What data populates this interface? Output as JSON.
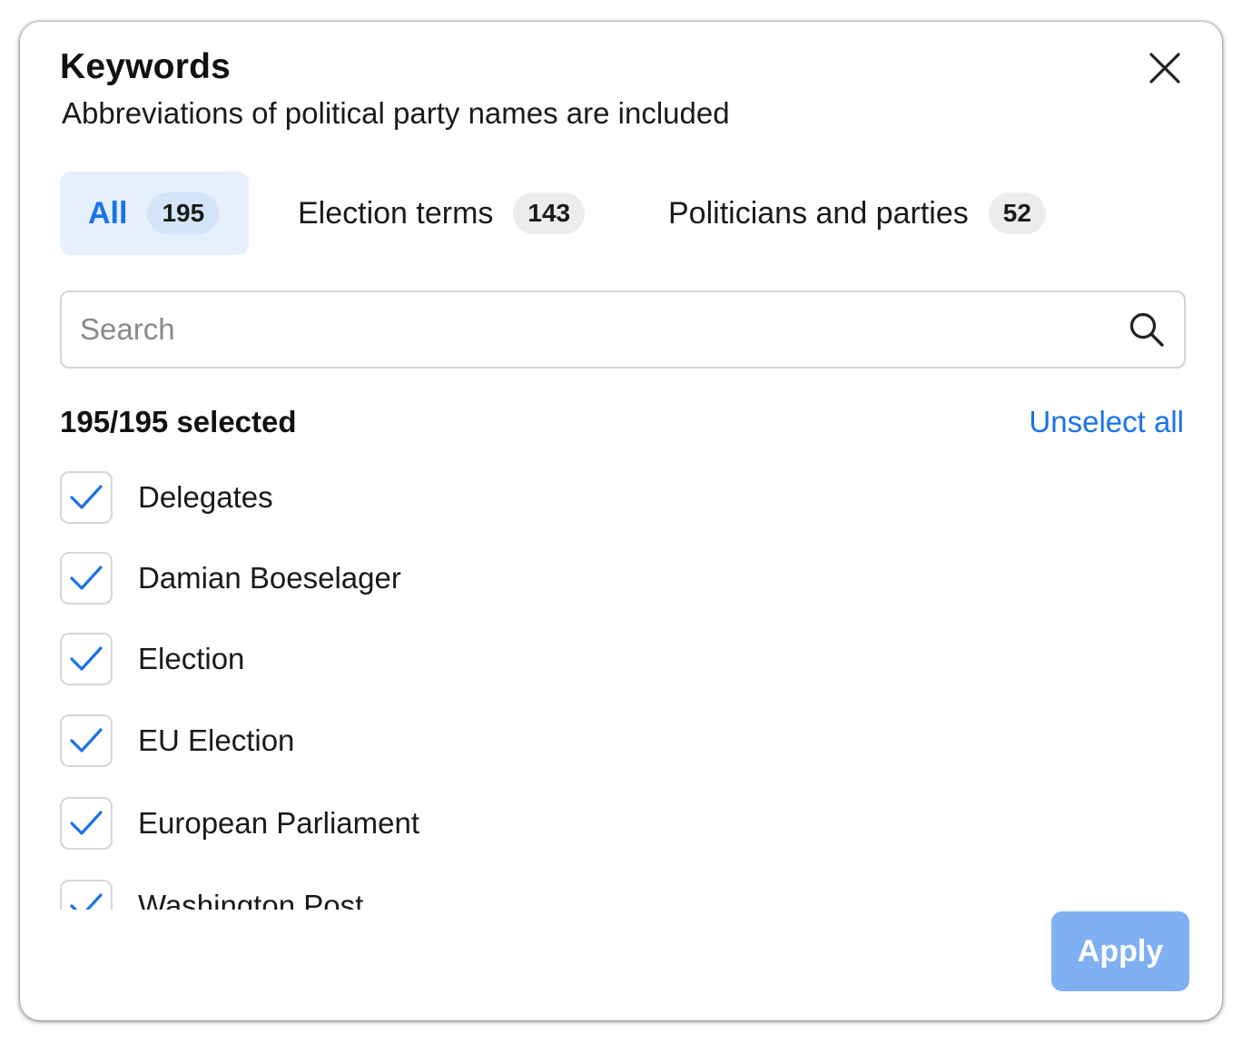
{
  "dialog": {
    "title": "Keywords",
    "subtitle": "Abbreviations of political party names are included",
    "close_icon": "close-icon"
  },
  "tabs": [
    {
      "label": "All",
      "count": "195",
      "selected": true
    },
    {
      "label": "Election terms",
      "count": "143",
      "selected": false
    },
    {
      "label": "Politicians and parties",
      "count": "52",
      "selected": false
    }
  ],
  "search": {
    "placeholder": "Search",
    "value": "",
    "icon": "search-icon"
  },
  "selection": {
    "summary": "195/195 selected",
    "unselect_all_label": "Unselect all"
  },
  "items": [
    {
      "label": "Delegates",
      "checked": true
    },
    {
      "label": "Damian Boeselager",
      "checked": true
    },
    {
      "label": "Election",
      "checked": true
    },
    {
      "label": "EU Election",
      "checked": true
    },
    {
      "label": "European Parliament",
      "checked": true
    },
    {
      "label": "Washington Post",
      "checked": true
    }
  ],
  "footer": {
    "apply_label": "Apply",
    "apply_enabled": false
  },
  "colors": {
    "accent": "#1a73e8",
    "tab_selected_bg": "#e6f0fd",
    "apply_disabled_bg": "#7fb0f2",
    "checkmark": "#1a73e8"
  }
}
